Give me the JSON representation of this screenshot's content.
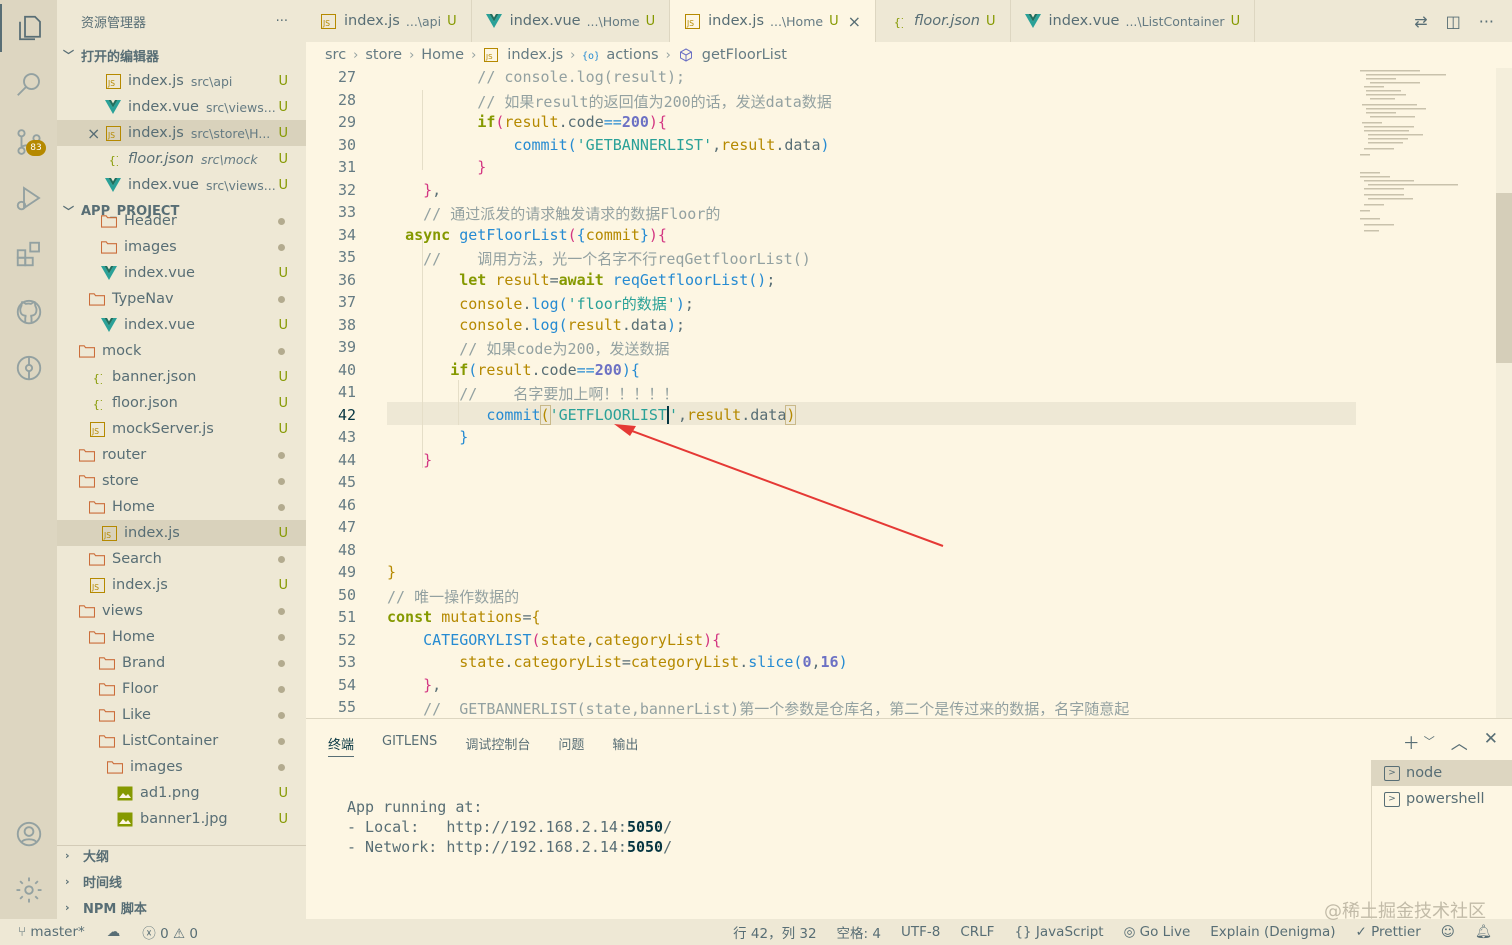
{
  "sidebar": {
    "title": "资源管理器",
    "more": "···",
    "open_editors_label": "打开的编辑器",
    "open_editors": [
      {
        "name": "index.js",
        "desc": "src\\api",
        "status": "U",
        "type": "js"
      },
      {
        "name": "index.vue",
        "desc": "src\\views...",
        "status": "U",
        "type": "vue"
      },
      {
        "name": "index.js",
        "desc": "src\\store\\H...",
        "status": "U",
        "type": "js",
        "close": "×"
      },
      {
        "name": "floor.json",
        "desc": "src\\mock",
        "status": "U",
        "type": "json"
      },
      {
        "name": "index.vue",
        "desc": "src\\views...",
        "status": "U",
        "type": "vue"
      }
    ],
    "project_label": "APP_PROJECT",
    "tree": [
      {
        "name": "Header",
        "type": "folder",
        "status": "dot"
      },
      {
        "name": "images",
        "type": "folder",
        "status": "dot"
      },
      {
        "name": "index.vue",
        "type": "vue",
        "status": "U"
      },
      {
        "name": "TypeNav",
        "type": "folder",
        "status": "dot"
      },
      {
        "name": "index.vue",
        "type": "vue",
        "status": "U"
      },
      {
        "name": "mock",
        "type": "folder",
        "status": "dot"
      },
      {
        "name": "banner.json",
        "type": "json",
        "status": "U"
      },
      {
        "name": "floor.json",
        "type": "json",
        "status": "U"
      },
      {
        "name": "mockServer.js",
        "type": "js",
        "status": "U"
      },
      {
        "name": "router",
        "type": "folder",
        "status": "dot"
      },
      {
        "name": "store",
        "type": "folder",
        "status": "dot"
      },
      {
        "name": "Home",
        "type": "folder",
        "status": "dot"
      },
      {
        "name": "index.js",
        "type": "js",
        "status": "U"
      },
      {
        "name": "Search",
        "type": "folder",
        "status": "dot"
      },
      {
        "name": "index.js",
        "type": "js",
        "status": "U"
      },
      {
        "name": "views",
        "type": "folder",
        "status": "dot"
      },
      {
        "name": "Home",
        "type": "folder",
        "status": "dot"
      },
      {
        "name": "Brand",
        "type": "folder",
        "status": "dot"
      },
      {
        "name": "Floor",
        "type": "folder",
        "status": "dot"
      },
      {
        "name": "Like",
        "type": "folder",
        "status": "dot"
      },
      {
        "name": "ListContainer",
        "type": "folder",
        "status": "dot"
      },
      {
        "name": "images",
        "type": "folder",
        "status": "dot"
      },
      {
        "name": "ad1.png",
        "type": "img",
        "status": "U"
      },
      {
        "name": "banner1.jpg",
        "type": "img",
        "status": "U"
      }
    ],
    "outline_label": "大纲",
    "timeline_label": "时间线",
    "npm_label": "NPM 脚本"
  },
  "activity": {
    "source_control_badge": "83"
  },
  "tabs": [
    {
      "name": "index.js",
      "desc": "...\\api",
      "status": "U",
      "type": "js"
    },
    {
      "name": "index.vue",
      "desc": "...\\Home",
      "status": "U",
      "type": "vue"
    },
    {
      "name": "index.js",
      "desc": "...\\Home",
      "status": "U",
      "type": "js",
      "close": "×"
    },
    {
      "name": "floor.json",
      "desc": "",
      "status": "U",
      "type": "json"
    },
    {
      "name": "index.vue",
      "desc": "...\\ListContainer",
      "status": "U",
      "type": "vue"
    }
  ],
  "breadcrumb": {
    "p1": "src",
    "p2": "store",
    "p3": "Home",
    "p4": "index.js",
    "p5": "actions",
    "p6": "getFloorList"
  },
  "editor": {
    "line_numbers": [
      "27",
      "28",
      "29",
      "30",
      "31",
      "32",
      "33",
      "34",
      "35",
      "36",
      "37",
      "38",
      "39",
      "40",
      "41",
      "42",
      "43",
      "44",
      "45",
      "46",
      "47",
      "48",
      "49",
      "50",
      "51",
      "52",
      "53",
      "54",
      "55"
    ],
    "current_line": 42
  },
  "panel": {
    "tabs": [
      "终端",
      "GITLENS",
      "调试控制台",
      "问题",
      "输出"
    ],
    "terminal_lines": {
      "l1": "App running at:",
      "l2_prefix": "- Local:   http://192.168.2.14:",
      "l3_prefix": "- Network: http://192.168.2.14:",
      "port": "5050",
      "slash": "/"
    },
    "terminals": [
      "node",
      "powershell"
    ]
  },
  "status": {
    "branch": "master*",
    "problems_errors": "0",
    "problems_warnings": "0",
    "position": "行 42，列 32",
    "spaces": "空格: 4",
    "encoding": "UTF-8",
    "eol": "CRLF",
    "language": "JavaScript",
    "go_live": "Go Live",
    "explain": "Explain (Denigma)",
    "prettier": "Prettier"
  },
  "watermark": "@稀土掘金技术社区",
  "colors": {
    "accent": "#268bd2",
    "keyword": "#859900",
    "string": "#2aa198",
    "number": "#6c71c4",
    "annotation_arrow": "#e53935"
  }
}
